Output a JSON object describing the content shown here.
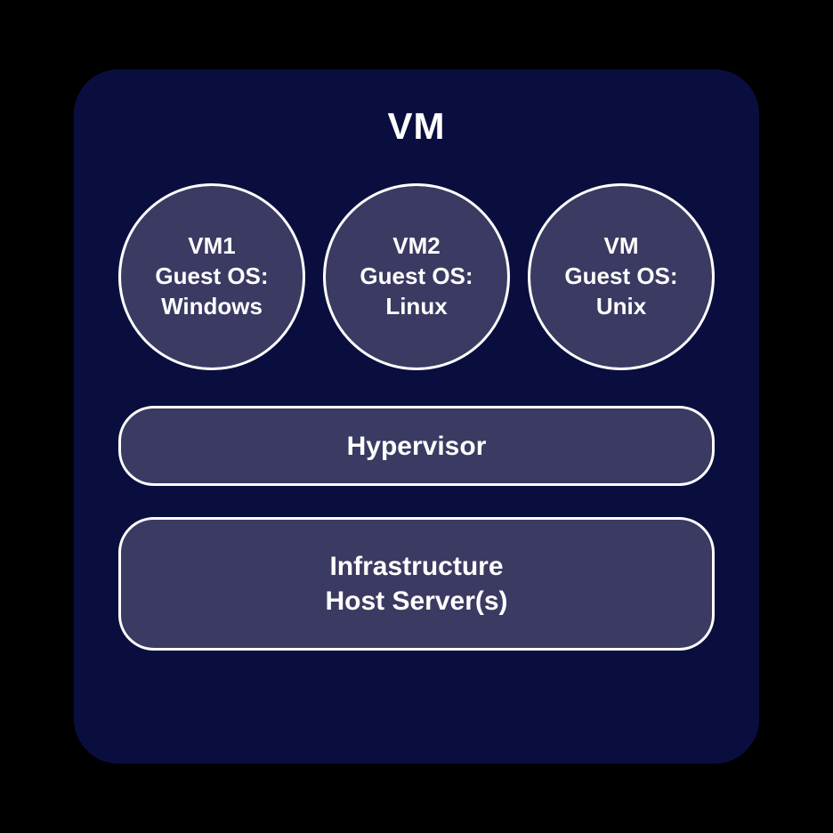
{
  "title": "VM",
  "vms": [
    {
      "name": "VM1",
      "guest_label": "Guest OS:",
      "os": "Windows"
    },
    {
      "name": "VM2",
      "guest_label": "Guest OS:",
      "os": "Linux"
    },
    {
      "name": "VM",
      "guest_label": "Guest OS:",
      "os": "Unix"
    }
  ],
  "hypervisor": {
    "label": "Hypervisor"
  },
  "infrastructure": {
    "line1": "Infrastructure",
    "line2": "Host Server(s)"
  }
}
